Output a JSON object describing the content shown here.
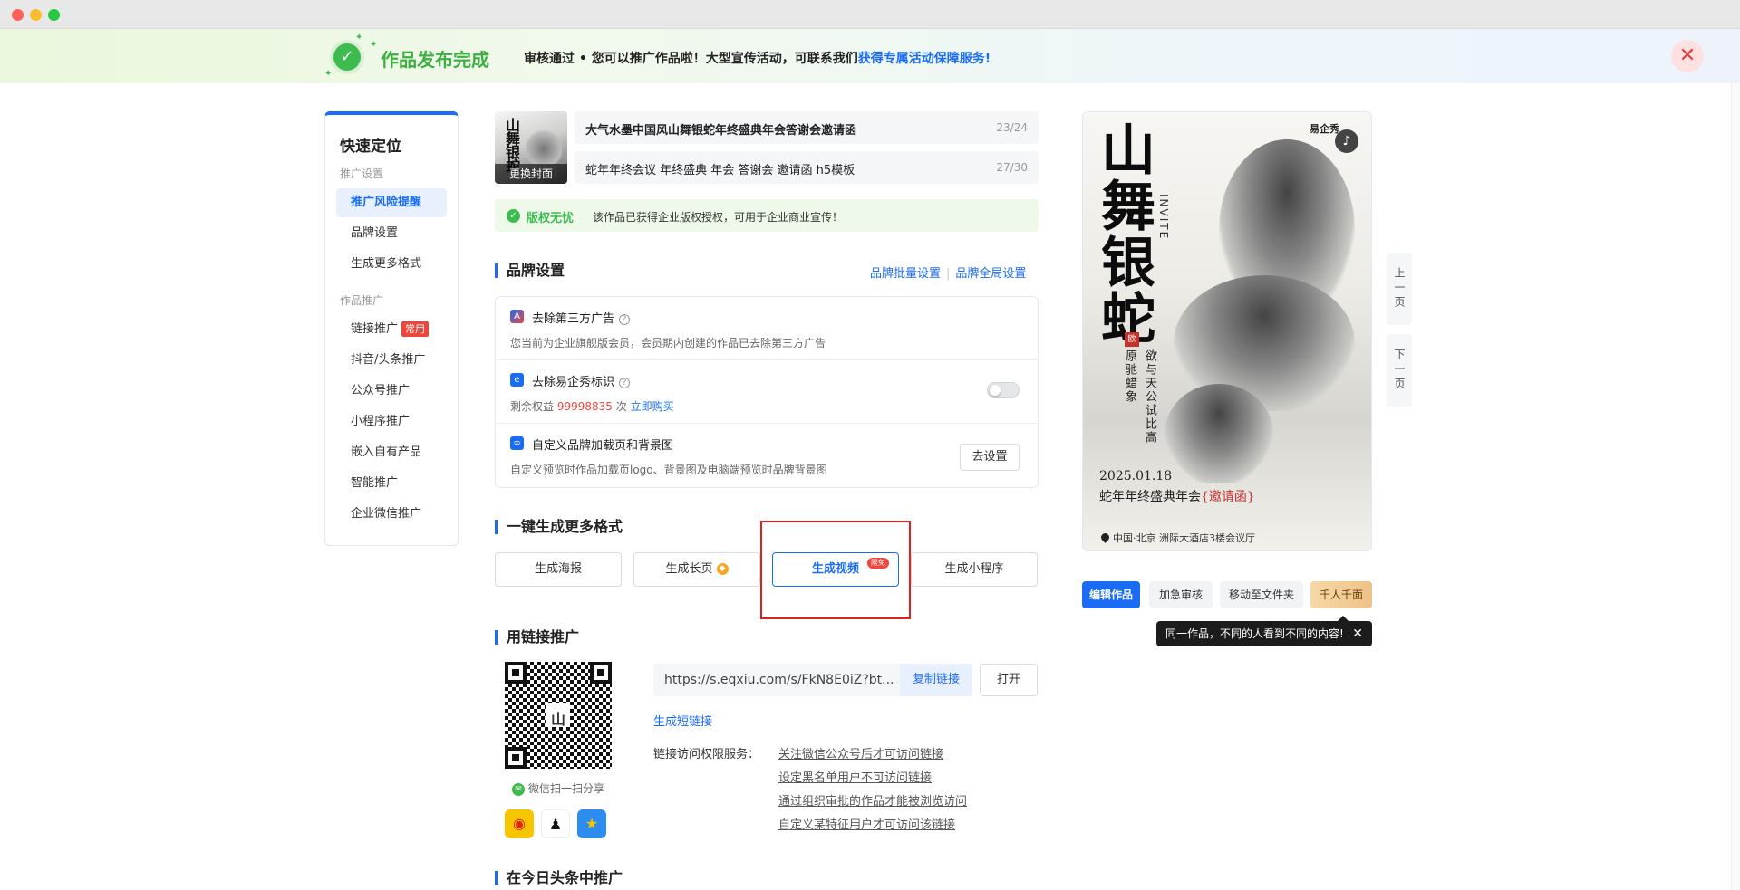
{
  "window": {
    "controls": [
      "close",
      "minimize",
      "maximize"
    ]
  },
  "banner": {
    "title": "作品发布完成",
    "message": "审核通过 • 您可以推广作品啦！大型宣传活动，可联系我们",
    "link": "获得专属活动保障服务!",
    "close_icon": "close-icon"
  },
  "leftnav": {
    "title": "快速定位",
    "group1": "推广设置",
    "group1_items": [
      "推广风险提醒",
      "品牌设置",
      "生成更多格式"
    ],
    "group2": "作品推广",
    "group2_items": [
      "链接推广",
      "抖音/头条推广",
      "公众号推广",
      "小程序推广",
      "嵌入自有产品",
      "智能推广",
      "企业微信推广"
    ],
    "hot_tag": "常用",
    "active_item": "推广风险提醒"
  },
  "work": {
    "cover_button": "更换封面",
    "cover_text": "山舞银蛇",
    "title": "大气水墨中国风山舞银蛇年终盛典年会答谢会邀请函",
    "title_count": "23/24",
    "desc": "蛇年年终会议 年终盛典 年会 答谢会 邀请函 h5模板",
    "desc_count": "27/30"
  },
  "copyright": {
    "label": "版权无忧",
    "text": "该作品已获得企业版权授权，可用于企业商业宣传！"
  },
  "brand": {
    "section_title": "品牌设置",
    "link_batch": "品牌批量设置",
    "link_global": "品牌全局设置",
    "rows": [
      {
        "name": "去除第三方广告",
        "desc": "您当前为企业旗舰版会员，会员期内创建的作品已去除第三方广告"
      },
      {
        "name": "去除易企秀标识",
        "desc_prefix": "剩余权益",
        "count": "99998835",
        "desc_unit": "次",
        "buy_link": "立即购买"
      },
      {
        "name": "自定义品牌加载页和背景图",
        "desc": "自定义预览时作品加载页logo、背景图及电脑端预览时品牌背景图",
        "button": "去设置"
      }
    ]
  },
  "formats": {
    "section_title": "一键生成更多格式",
    "buttons": [
      "生成海报",
      "生成长页",
      "生成视频",
      "生成小程序"
    ],
    "free_badge": "限免",
    "vip_icon": "diamond-icon"
  },
  "link_promo": {
    "section_title": "用链接推广",
    "url": "https://s.eqxiu.com/s/FkN8E0iZ?bt...",
    "copy_button": "复制链接",
    "open_button": "打开",
    "short_link": "生成短链接",
    "wechat_share": "微信扫一扫分享",
    "perm_label": "链接访问权限服务：",
    "perm_links": [
      "关注微信公众号后才可访问链接",
      "设定黑名单用户不可访问链接",
      "通过组织审批的作品才能被浏览访问",
      "自定义某特征用户才可访问该链接"
    ],
    "share_icons": [
      "weibo-icon",
      "qq-icon",
      "qzone-icon"
    ]
  },
  "toutiao": {
    "section_title": "在今日头条中推广"
  },
  "poster": {
    "logo": "易企秀",
    "title": "山舞银蛇",
    "invite": "INVITE",
    "seal": "欧",
    "verse1": "欲与天公试比高",
    "verse2": "原驰蜡象",
    "date": "2025.01.18",
    "subtitle_prefix": "蛇年年终盛典年会",
    "subtitle_highlight": "{邀请函}",
    "address": "中国·北京 洲际大酒店3楼会议厅"
  },
  "paging": {
    "prev": "上一页",
    "next": "下一页"
  },
  "actions": {
    "buttons": [
      "编辑作品",
      "加急审核",
      "移动至文件夹",
      "千人千面"
    ],
    "tip": "同一作品，不同的人看到不同的内容!"
  },
  "colors": {
    "accent": "#1a6cf5",
    "success": "#3dbb4f",
    "danger": "#f0453a",
    "highlight": "#e02020"
  }
}
